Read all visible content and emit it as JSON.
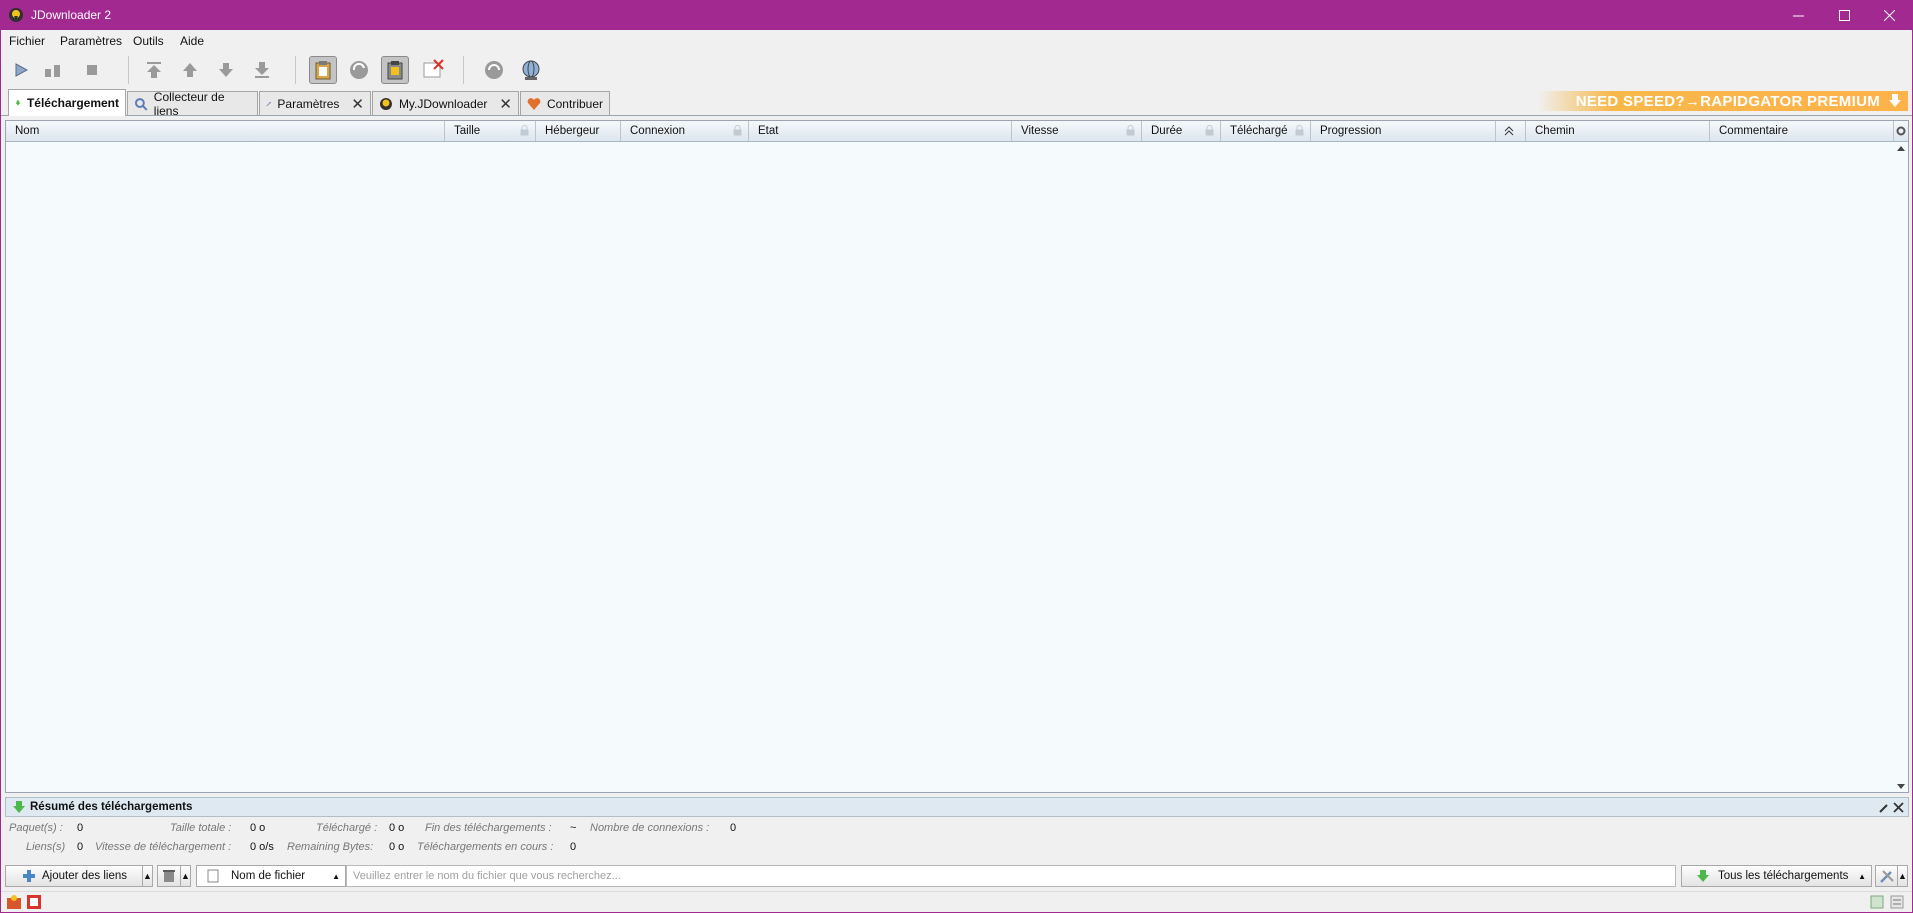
{
  "window": {
    "title": "JDownloader 2"
  },
  "menu": [
    "Fichier",
    "Paramètres",
    "Outils",
    "Aide"
  ],
  "tabs": [
    {
      "label": "Téléchargement",
      "icon": "download-arrow-icon",
      "closable": false,
      "active": true
    },
    {
      "label": "Collecteur de liens",
      "icon": "linkgrabber-icon",
      "closable": false
    },
    {
      "label": "Paramètres",
      "icon": "settings-wrench-icon",
      "closable": true
    },
    {
      "label": "My.JDownloader",
      "icon": "myjd-icon",
      "closable": true
    },
    {
      "label": "Contribuer",
      "icon": "heart-icon",
      "closable": false
    }
  ],
  "promo": {
    "text": "NEED SPEED?→RAPIDGATOR PREMIUM"
  },
  "columns": [
    "Nom",
    "Taille",
    "Hébergeur",
    "Connexion",
    "Etat",
    "Vitesse",
    "Durée",
    "Téléchargé",
    "Progression",
    "",
    "Chemin",
    "Commentaire"
  ],
  "summary": {
    "title": "Résumé des téléchargements",
    "paquets_label": "Paquet(s) :",
    "paquets_value": "0",
    "taille_label": "Taille totale :",
    "taille_value": "0 o",
    "telecharge_label": "Téléchargé :",
    "telecharge_value": "0 o",
    "fin_label": "Fin des téléchargements :",
    "fin_value": "~",
    "connexions_label": "Nombre de connexions :",
    "connexions_value": "0",
    "liens_label": "Liens(s)",
    "liens_value": "0",
    "vitesse_label": "Vitesse de téléchargement :",
    "vitesse_value": "0 o/s",
    "remaining_label": "Remaining Bytes:",
    "remaining_value": "0 o",
    "encours_label": "Téléchargements en cours :",
    "encours_value": "0"
  },
  "bottom": {
    "add_links": "Ajouter des liens",
    "search_field": "Nom de fichier",
    "search_placeholder": "Veuillez entrer le nom du fichier que vous recherchez...",
    "filter": "Tous les téléchargements"
  },
  "colors": {
    "titlebar": "#a1298f",
    "table_bg": "#f5fbfd",
    "promo": "#ffb24a"
  }
}
